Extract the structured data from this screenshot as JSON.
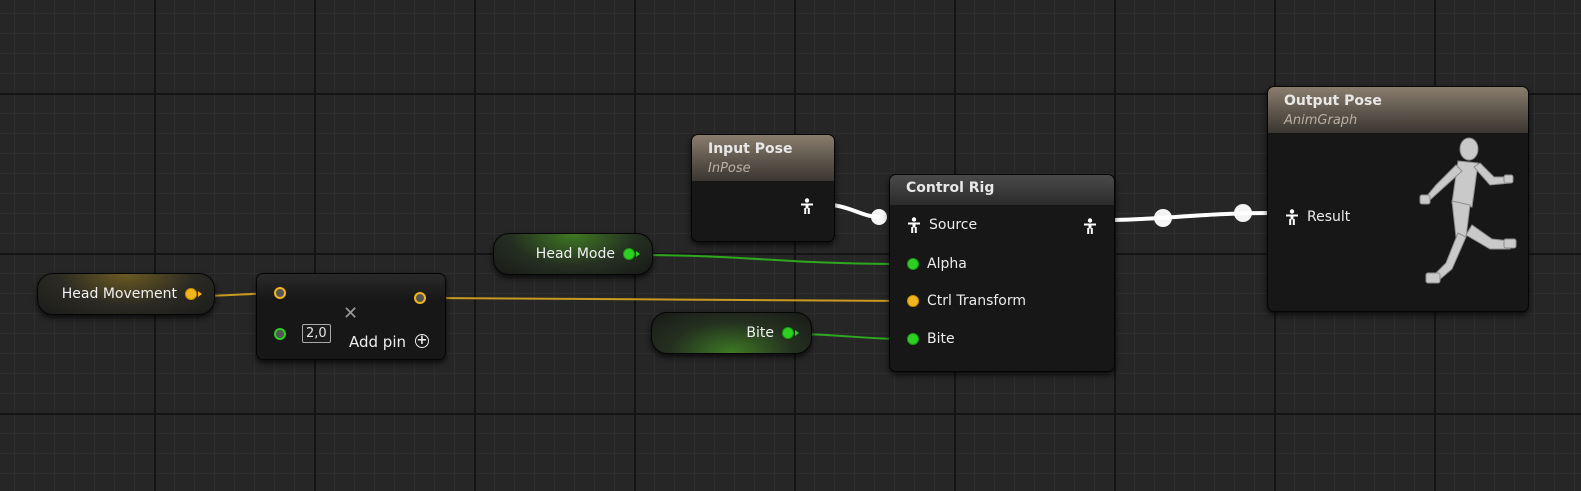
{
  "colors": {
    "float_pin": "#f2b51d",
    "bool_pin": "#2dcf22",
    "exec_wire": "#ffffff",
    "background": "#262626"
  },
  "nodes": {
    "head_movement": {
      "label": "Head Movement",
      "pin_type": "float"
    },
    "make_array": {
      "index_value": "2,0",
      "add_pin_label": "Add pin",
      "remove_icon": "close-icon",
      "add_icon": "plus-circle-icon"
    },
    "head_mode": {
      "label": "Head Mode",
      "pin_type": "bool"
    },
    "bite_var": {
      "label": "Bite",
      "pin_type": "bool"
    },
    "input_pose": {
      "title": "Input Pose",
      "subtitle": "InPose"
    },
    "control_rig": {
      "title": "Control Rig",
      "pins": [
        {
          "label": "Source",
          "type": "pose"
        },
        {
          "label": "Alpha",
          "type": "bool"
        },
        {
          "label": "Ctrl Transform",
          "type": "float"
        },
        {
          "label": "Bite",
          "type": "bool"
        }
      ]
    },
    "output_pose": {
      "title": "Output Pose",
      "subtitle": "AnimGraph",
      "result_label": "Result",
      "preview_icon": "running-mannequin-icon"
    }
  }
}
